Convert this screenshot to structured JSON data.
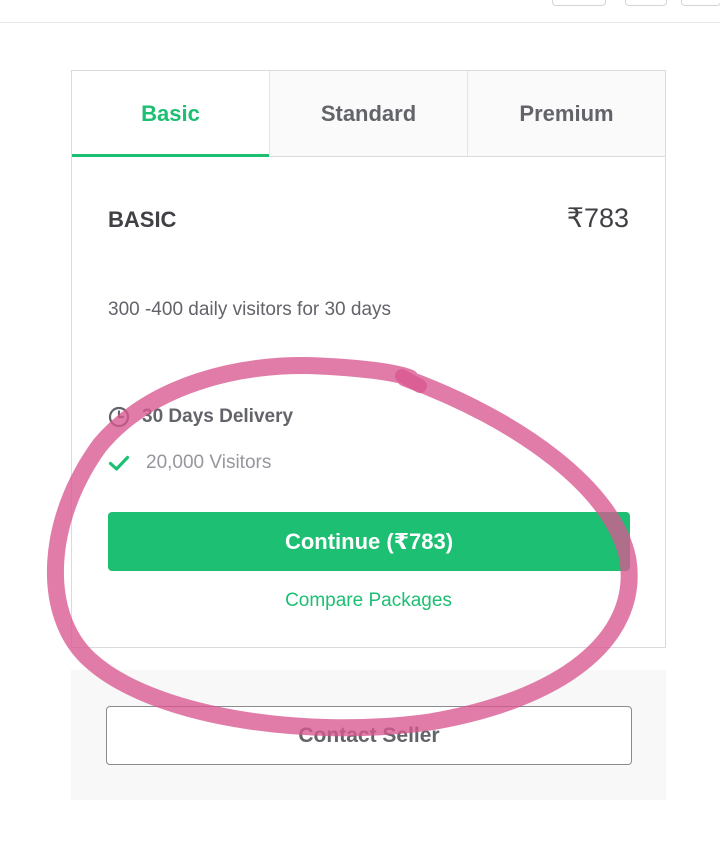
{
  "tabs": [
    {
      "label": "Basic",
      "active": true
    },
    {
      "label": "Standard",
      "active": false
    },
    {
      "label": "Premium",
      "active": false
    }
  ],
  "package": {
    "name": "BASIC",
    "price": "₹783",
    "description": "300 -400 daily visitors for 30 days",
    "delivery": "30 Days Delivery",
    "features": [
      "20,000 Visitors"
    ],
    "delivery_icon": "clock-icon",
    "feature_icon": "checkmark-icon"
  },
  "actions": {
    "continue_label": "Continue (₹783)",
    "compare_label": "Compare Packages",
    "contact_label": "Contact Seller"
  },
  "colors": {
    "accent": "#1dbf73",
    "annotation": "#d9578f"
  }
}
